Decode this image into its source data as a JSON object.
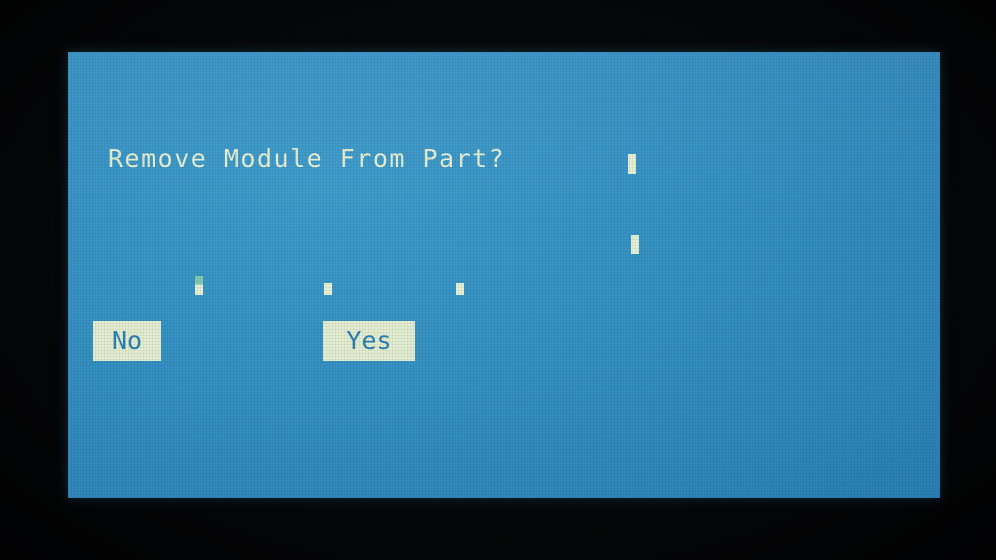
{
  "dialog": {
    "prompt": "Remove Module From Part?",
    "buttons": {
      "no_label": "No",
      "yes_label": "Yes"
    }
  },
  "colors": {
    "screen_background": "#3591c3",
    "text": "#e6f0d4",
    "button_fill": "#e3edd0",
    "button_text": "#2d7fb3"
  }
}
